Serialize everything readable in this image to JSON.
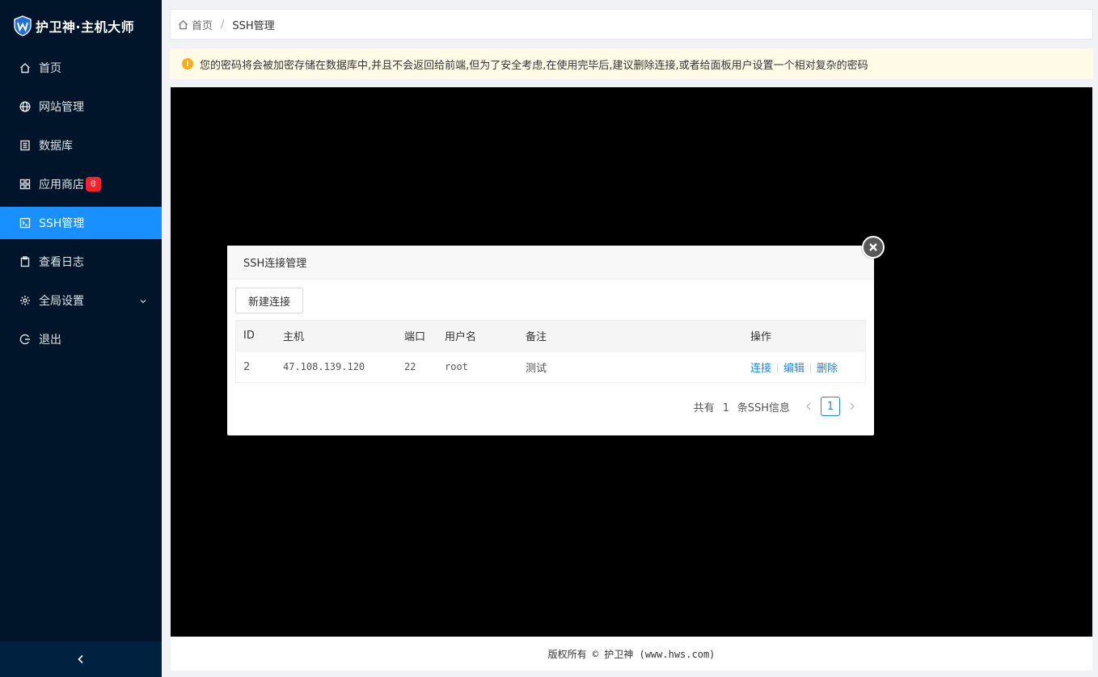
{
  "app": {
    "title": "护卫神·主机大师",
    "colors": {
      "sidebar_bg": "#001529",
      "accent": "#1890ff",
      "alert_bg": "#fffbe6",
      "warning": "#faad14",
      "badge": "#f5222d",
      "link": "#1e88e5"
    }
  },
  "sidebar": {
    "items": [
      {
        "label": "首页",
        "icon": "home-icon"
      },
      {
        "label": "网站管理",
        "icon": "globe-icon"
      },
      {
        "label": "数据库",
        "icon": "database-icon"
      },
      {
        "label": "应用商店",
        "icon": "app-grid-icon",
        "badge": "0"
      },
      {
        "label": "SSH管理",
        "icon": "terminal-icon",
        "active": true
      },
      {
        "label": "查看日志",
        "icon": "clipboard-icon"
      },
      {
        "label": "全局设置",
        "icon": "gear-icon",
        "has_submenu": true
      },
      {
        "label": "退出",
        "icon": "logout-icon"
      }
    ],
    "collapse_icon": "chevron-left-icon"
  },
  "breadcrumb": {
    "home": "首页",
    "separator": "/",
    "current": "SSH管理"
  },
  "alert": {
    "icon": "warning-icon",
    "text": "您的密码将会被加密存储在数据库中,并且不会返回给前端,但为了安全考虑,在使用完毕后,建议删除连接,或者给面板用户设置一个相对复杂的密码"
  },
  "footer": {
    "text": "版权所有 © 护卫神 (www.hws.com)"
  },
  "modal": {
    "title": "SSH连接管理",
    "new_button": "新建连接",
    "table": {
      "headers": {
        "id": "ID",
        "host": "主机",
        "port": "端口",
        "user": "用户名",
        "note": "备注",
        "actions": "操作"
      },
      "rows": [
        {
          "id": "2",
          "host": "47.108.139.120",
          "port": "22",
          "user": "root",
          "note": "测试"
        }
      ],
      "actions": {
        "connect": "连接",
        "edit": "编辑",
        "delete": "删除"
      }
    },
    "pager": {
      "prefix": "共有",
      "count": "1",
      "suffix": "条SSH信息",
      "current_page": "1"
    }
  }
}
